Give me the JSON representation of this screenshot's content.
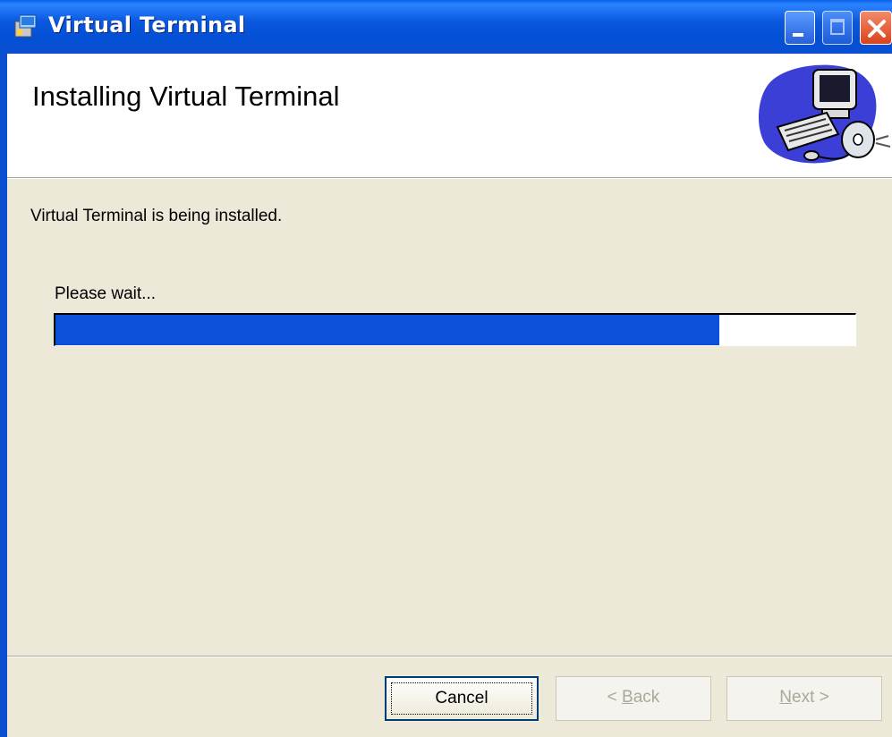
{
  "window": {
    "title": "Virtual Terminal",
    "titlebar_color": "#0a58df",
    "buttons": [
      "minimize",
      "maximize",
      "close"
    ]
  },
  "banner": {
    "title": "Installing Virtual Terminal",
    "graphic": "computer-with-cd-icon"
  },
  "body": {
    "status": "Virtual Terminal is being installed.",
    "wait_label": "Please wait...",
    "progress_fraction": 0.83,
    "progress_color": "#0a50d8"
  },
  "footer": {
    "cancel_label": "Cancel",
    "back_prefix": "< ",
    "back_access": "B",
    "back_rest": "ack",
    "next_access": "N",
    "next_rest": "ext >"
  }
}
